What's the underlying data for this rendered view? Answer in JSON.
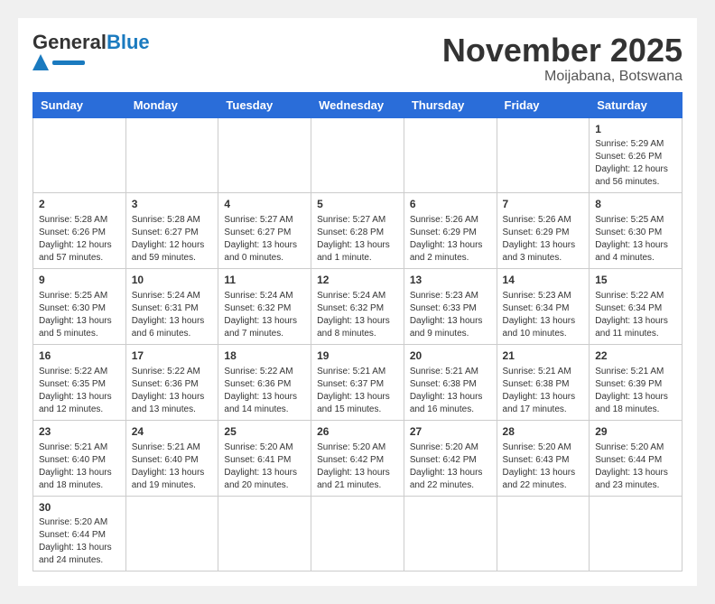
{
  "logo": {
    "general": "General",
    "blue": "Blue"
  },
  "header": {
    "month": "November 2025",
    "location": "Moijabana, Botswana"
  },
  "days_of_week": [
    "Sunday",
    "Monday",
    "Tuesday",
    "Wednesday",
    "Thursday",
    "Friday",
    "Saturday"
  ],
  "weeks": [
    [
      {
        "day": "",
        "info": ""
      },
      {
        "day": "",
        "info": ""
      },
      {
        "day": "",
        "info": ""
      },
      {
        "day": "",
        "info": ""
      },
      {
        "day": "",
        "info": ""
      },
      {
        "day": "",
        "info": ""
      },
      {
        "day": "1",
        "info": "Sunrise: 5:29 AM\nSunset: 6:26 PM\nDaylight: 12 hours and 56 minutes."
      }
    ],
    [
      {
        "day": "2",
        "info": "Sunrise: 5:28 AM\nSunset: 6:26 PM\nDaylight: 12 hours and 57 minutes."
      },
      {
        "day": "3",
        "info": "Sunrise: 5:28 AM\nSunset: 6:27 PM\nDaylight: 12 hours and 59 minutes."
      },
      {
        "day": "4",
        "info": "Sunrise: 5:27 AM\nSunset: 6:27 PM\nDaylight: 13 hours and 0 minutes."
      },
      {
        "day": "5",
        "info": "Sunrise: 5:27 AM\nSunset: 6:28 PM\nDaylight: 13 hours and 1 minute."
      },
      {
        "day": "6",
        "info": "Sunrise: 5:26 AM\nSunset: 6:29 PM\nDaylight: 13 hours and 2 minutes."
      },
      {
        "day": "7",
        "info": "Sunrise: 5:26 AM\nSunset: 6:29 PM\nDaylight: 13 hours and 3 minutes."
      },
      {
        "day": "8",
        "info": "Sunrise: 5:25 AM\nSunset: 6:30 PM\nDaylight: 13 hours and 4 minutes."
      }
    ],
    [
      {
        "day": "9",
        "info": "Sunrise: 5:25 AM\nSunset: 6:30 PM\nDaylight: 13 hours and 5 minutes."
      },
      {
        "day": "10",
        "info": "Sunrise: 5:24 AM\nSunset: 6:31 PM\nDaylight: 13 hours and 6 minutes."
      },
      {
        "day": "11",
        "info": "Sunrise: 5:24 AM\nSunset: 6:32 PM\nDaylight: 13 hours and 7 minutes."
      },
      {
        "day": "12",
        "info": "Sunrise: 5:24 AM\nSunset: 6:32 PM\nDaylight: 13 hours and 8 minutes."
      },
      {
        "day": "13",
        "info": "Sunrise: 5:23 AM\nSunset: 6:33 PM\nDaylight: 13 hours and 9 minutes."
      },
      {
        "day": "14",
        "info": "Sunrise: 5:23 AM\nSunset: 6:34 PM\nDaylight: 13 hours and 10 minutes."
      },
      {
        "day": "15",
        "info": "Sunrise: 5:22 AM\nSunset: 6:34 PM\nDaylight: 13 hours and 11 minutes."
      }
    ],
    [
      {
        "day": "16",
        "info": "Sunrise: 5:22 AM\nSunset: 6:35 PM\nDaylight: 13 hours and 12 minutes."
      },
      {
        "day": "17",
        "info": "Sunrise: 5:22 AM\nSunset: 6:36 PM\nDaylight: 13 hours and 13 minutes."
      },
      {
        "day": "18",
        "info": "Sunrise: 5:22 AM\nSunset: 6:36 PM\nDaylight: 13 hours and 14 minutes."
      },
      {
        "day": "19",
        "info": "Sunrise: 5:21 AM\nSunset: 6:37 PM\nDaylight: 13 hours and 15 minutes."
      },
      {
        "day": "20",
        "info": "Sunrise: 5:21 AM\nSunset: 6:38 PM\nDaylight: 13 hours and 16 minutes."
      },
      {
        "day": "21",
        "info": "Sunrise: 5:21 AM\nSunset: 6:38 PM\nDaylight: 13 hours and 17 minutes."
      },
      {
        "day": "22",
        "info": "Sunrise: 5:21 AM\nSunset: 6:39 PM\nDaylight: 13 hours and 18 minutes."
      }
    ],
    [
      {
        "day": "23",
        "info": "Sunrise: 5:21 AM\nSunset: 6:40 PM\nDaylight: 13 hours and 18 minutes."
      },
      {
        "day": "24",
        "info": "Sunrise: 5:21 AM\nSunset: 6:40 PM\nDaylight: 13 hours and 19 minutes."
      },
      {
        "day": "25",
        "info": "Sunrise: 5:20 AM\nSunset: 6:41 PM\nDaylight: 13 hours and 20 minutes."
      },
      {
        "day": "26",
        "info": "Sunrise: 5:20 AM\nSunset: 6:42 PM\nDaylight: 13 hours and 21 minutes."
      },
      {
        "day": "27",
        "info": "Sunrise: 5:20 AM\nSunset: 6:42 PM\nDaylight: 13 hours and 22 minutes."
      },
      {
        "day": "28",
        "info": "Sunrise: 5:20 AM\nSunset: 6:43 PM\nDaylight: 13 hours and 22 minutes."
      },
      {
        "day": "29",
        "info": "Sunrise: 5:20 AM\nSunset: 6:44 PM\nDaylight: 13 hours and 23 minutes."
      }
    ],
    [
      {
        "day": "30",
        "info": "Sunrise: 5:20 AM\nSunset: 6:44 PM\nDaylight: 13 hours and 24 minutes."
      },
      {
        "day": "",
        "info": ""
      },
      {
        "day": "",
        "info": ""
      },
      {
        "day": "",
        "info": ""
      },
      {
        "day": "",
        "info": ""
      },
      {
        "day": "",
        "info": ""
      },
      {
        "day": "",
        "info": ""
      }
    ]
  ]
}
